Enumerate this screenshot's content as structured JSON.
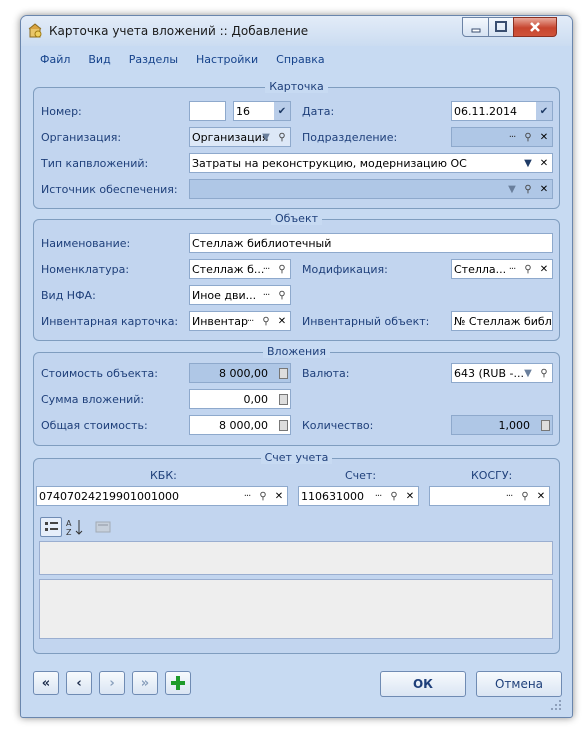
{
  "window": {
    "title": "Карточка учета вложений :: Добавление"
  },
  "menu": [
    "Файл",
    "Вид",
    "Разделы",
    "Настройки",
    "Справка"
  ],
  "card": {
    "title": "Карточка",
    "number_label": "Номер:",
    "number_value": "",
    "number_suffix": "16",
    "date_label": "Дата:",
    "date_value": "06.11.2014",
    "org_label": "Организация:",
    "org_value": "Организация",
    "subdivision_label": "Подразделение:",
    "subdivision_value": "",
    "cap_type_label": "Тип капвложений:",
    "cap_type_value": "Затраты на реконструкцию, модернизацию ОС",
    "source_label": "Источник обеспечения:",
    "source_value": ""
  },
  "object": {
    "title": "Объект",
    "name_label": "Наименование:",
    "name_value": "Стеллаж библиотечный",
    "nomenclature_label": "Номенклатура:",
    "nomenclature_value": "Стеллаж б...",
    "modification_label": "Модификация:",
    "modification_value": "Стелла...",
    "nfa_label": "Вид НФА:",
    "nfa_value": "Иное дви...",
    "inv_card_label": "Инвентарная карточка:",
    "inv_card_value": "Инвентар",
    "inv_object_label": "Инвентарный объект:",
    "inv_object_value": "№ Стеллаж библис"
  },
  "investments": {
    "title": "Вложения",
    "obj_cost_label": "Стоимость объекта:",
    "obj_cost_value": "8 000,00",
    "currency_label": "Валюта:",
    "currency_value": "643 (RUB -...",
    "invest_sum_label": "Сумма вложений:",
    "invest_sum_value": "0,00",
    "total_label": "Общая стоимость:",
    "total_value": "8 000,00",
    "qty_label": "Количество:",
    "qty_value": "1,000"
  },
  "account": {
    "title": "Счет учета",
    "kbk_header": "КБК:",
    "kbk_value": "07407024219901001000",
    "acc_header": "Счет:",
    "acc_value": "110631000",
    "kosgu_header": "КОСГУ:",
    "kosgu_value": ""
  },
  "footer": {
    "ok_label": "ОК",
    "cancel_label": "Отмена"
  },
  "colors": {
    "accent": "#1e3f7a",
    "background": "#c7daf2",
    "close": "#c7452e"
  }
}
